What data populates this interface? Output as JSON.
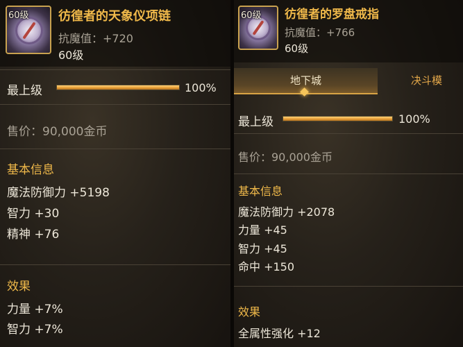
{
  "left": {
    "level_tag": "60级",
    "name": "彷徨者的天象仪项链",
    "resist": "抗魔值：+720",
    "level": "60级",
    "upgrade": {
      "label": "最上级",
      "percent": "100%",
      "fill": 1.0
    },
    "price": "售价：90,000金币",
    "basic_title": "基本信息",
    "stats": [
      "魔法防御力 +5198",
      "智力 +30",
      "精神 +76"
    ],
    "effect_title": "效果",
    "effects": [
      "力量 +7%",
      "智力 +7%"
    ]
  },
  "right": {
    "level_tag": "60级",
    "name": "彷徨者的罗盘戒指",
    "resist": "抗魔值：+766",
    "level": "60级",
    "tabs": [
      "地下城",
      "决斗模"
    ],
    "upgrade": {
      "label": "最上级",
      "percent": "100%",
      "fill": 1.0
    },
    "price": "售价：90,000金币",
    "basic_title": "基本信息",
    "stats": [
      "魔法防御力 +2078",
      "力量 +45",
      "智力 +45",
      "命中 +150"
    ],
    "effect_title": "效果",
    "effects": [
      "全属性强化 +12"
    ]
  },
  "colors": {
    "gold_text": "#f0b94a",
    "bar_fill": "#e8a13a",
    "frame": "#c9a24f"
  },
  "icons": {
    "left": "astrolabe-necklace-icon",
    "right": "compass-ring-icon"
  }
}
